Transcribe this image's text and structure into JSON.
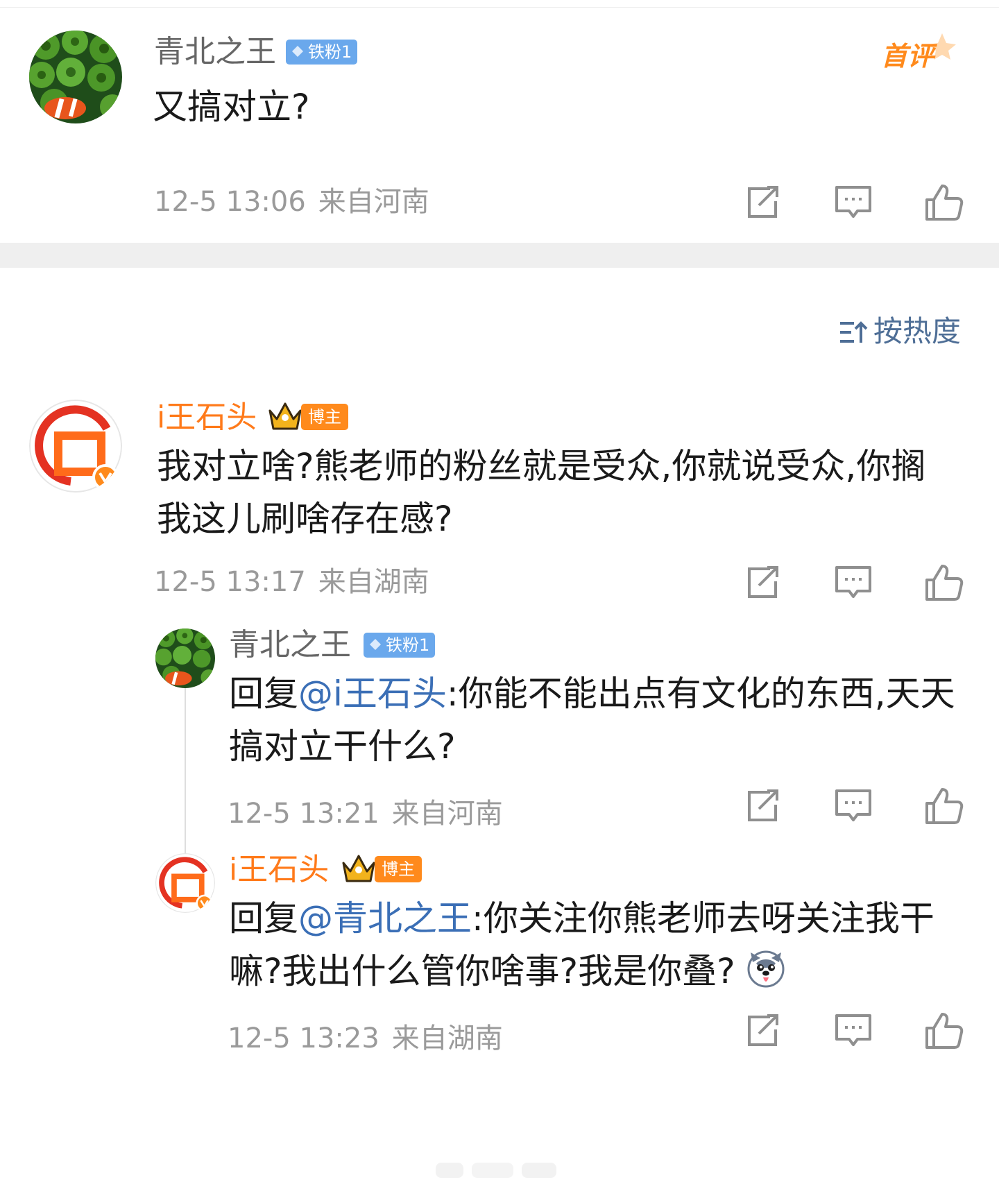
{
  "first_badge": "首评",
  "top_comment": {
    "username": "青北之王",
    "badge": "铁粉1",
    "text": "又搞对立?",
    "time": "12-5 13:06",
    "location": "来自河南"
  },
  "sort_label": "按热度",
  "comments": [
    {
      "username": "i王石头",
      "badge": "博主",
      "text": "我对立啥?熊老师的粉丝就是受众,你就说受众,你搁我这儿刷啥存在感?",
      "time": "12-5 13:17",
      "location": "来自湖南",
      "replies": [
        {
          "username": "青北之王",
          "badge": "铁粉1",
          "reply_prefix": "回复",
          "mention": "@i王石头",
          "text": ":你能不能出点有文化的东西,天天搞对立干什么?",
          "time": "12-5 13:21",
          "location": "来自河南"
        },
        {
          "username": "i王石头",
          "badge": "博主",
          "reply_prefix": "回复",
          "mention": "@青北之王",
          "text": ":你关注你熊老师去呀关注我干嘛?我出什么管你啥事?我是你叠?",
          "emoji": "husky-emoji",
          "time": "12-5 13:23",
          "location": "来自湖南"
        }
      ]
    }
  ],
  "icons": [
    "share-icon",
    "comment-icon",
    "like-icon",
    "sort-icon",
    "diamond-icon",
    "crown-icon"
  ],
  "colors": {
    "mention": "#3b6fb6",
    "host_name": "#ff7a1a",
    "fan_badge": "#6aa8ec",
    "host_badge": "#ff8a1c",
    "meta": "#9a9a9a"
  }
}
